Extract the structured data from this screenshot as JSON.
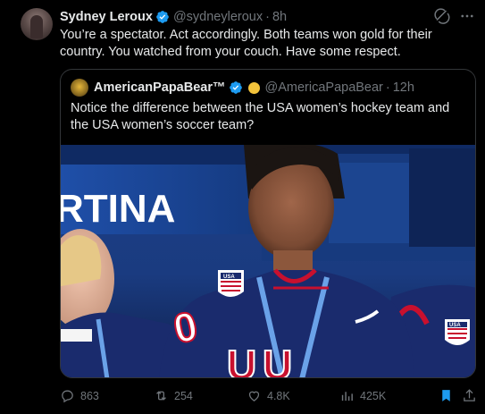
{
  "tweet": {
    "author_name": "Sydney Leroux",
    "author_handle": "@sydneyleroux",
    "separator": "·",
    "time": "8h",
    "text": "You’re a spectator. Act accordingly. Both teams won gold for their country. You watched from your couch. Have some respect."
  },
  "quote": {
    "author_name": "AmericanPapaBear™",
    "author_handle": "@AmericaPapaBear",
    "separator": "·",
    "time": "12h",
    "text": "Notice the difference between the USA women’s hockey team and the USA women’s soccer team?",
    "media": {
      "board_text": "RTINA",
      "jersey_number": "0",
      "jersey_letters": "U",
      "flag_label": "USA"
    }
  },
  "actions": {
    "replies": "863",
    "reposts": "254",
    "likes": "4.8K",
    "views": "425K"
  },
  "colors": {
    "background": "#000000",
    "text": "#e7e9ea",
    "muted": "#71767b",
    "accent": "#1d9bf0",
    "border": "#333639",
    "jersey_navy": "#1a2b6d",
    "jersey_red": "#c8102e"
  },
  "icons": [
    "verified-badge-icon",
    "grok-icon",
    "more-icon",
    "reply-icon",
    "repost-icon",
    "like-icon",
    "views-icon",
    "bookmark-icon",
    "share-icon"
  ]
}
